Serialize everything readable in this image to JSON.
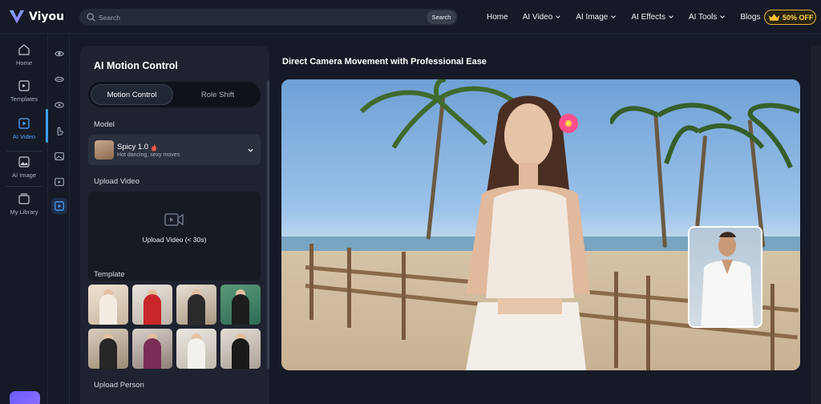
{
  "brand": {
    "name": "Viyou"
  },
  "search": {
    "placeholder": "Search",
    "button_label": "Search"
  },
  "nav": {
    "items": [
      "Home",
      "AI Video",
      "AI Image",
      "AI Effects",
      "AI Tools",
      "Blogs"
    ]
  },
  "promo": {
    "label": "50% OFF"
  },
  "rail": {
    "items": [
      {
        "label": "Home",
        "icon": "home-icon"
      },
      {
        "label": "Templates",
        "icon": "templates-icon"
      },
      {
        "label": "AI Video",
        "icon": "video-icon",
        "active": true
      },
      {
        "label": "AI Image",
        "icon": "image-icon"
      },
      {
        "label": "My Library",
        "icon": "library-icon"
      }
    ]
  },
  "panel": {
    "title": "AI Motion Control",
    "tabs": [
      "Motion Control",
      "Role Shift"
    ],
    "model_label": "Model",
    "model": {
      "name": "Spicy 1.0",
      "description": "Hot dancing, sexy moves"
    },
    "upload_label": "Upload Video",
    "upload_hint": "Upload Video (< 30s)",
    "template_label": "Template",
    "next_section_label": "Upload Person"
  },
  "main": {
    "title": "Direct Camera Movement with Professional Ease"
  },
  "colors": {
    "accent": "#3ea0ff",
    "promo": "#ffd24a",
    "panel_bg": "#1f232f",
    "page_bg": "#161a26"
  }
}
